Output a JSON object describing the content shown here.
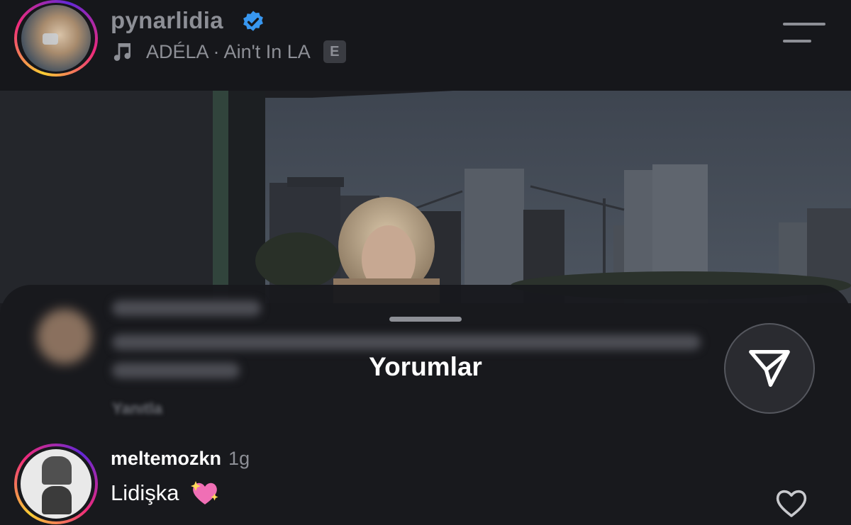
{
  "header": {
    "username": "pynarlidia",
    "song": "ADÉLA · Ain't In LA",
    "explicit_badge": "E",
    "icons": [
      "verified-badge-icon",
      "music-note-icon",
      "menu-icon"
    ]
  },
  "sheet": {
    "title": "Yorumlar",
    "blurred_reply_label": "Yanıtla"
  },
  "comment": {
    "username": "meltemozkn",
    "time": "1g",
    "text": "Lidişka",
    "emoji_icon": "sparkling-heart-icon",
    "like_icon": "heart-outline-icon"
  },
  "colors": {
    "background": "#1b1c20",
    "header_bg": "#16171b",
    "muted_text": "#8d8f96",
    "verified_blue": "#3897f0"
  }
}
